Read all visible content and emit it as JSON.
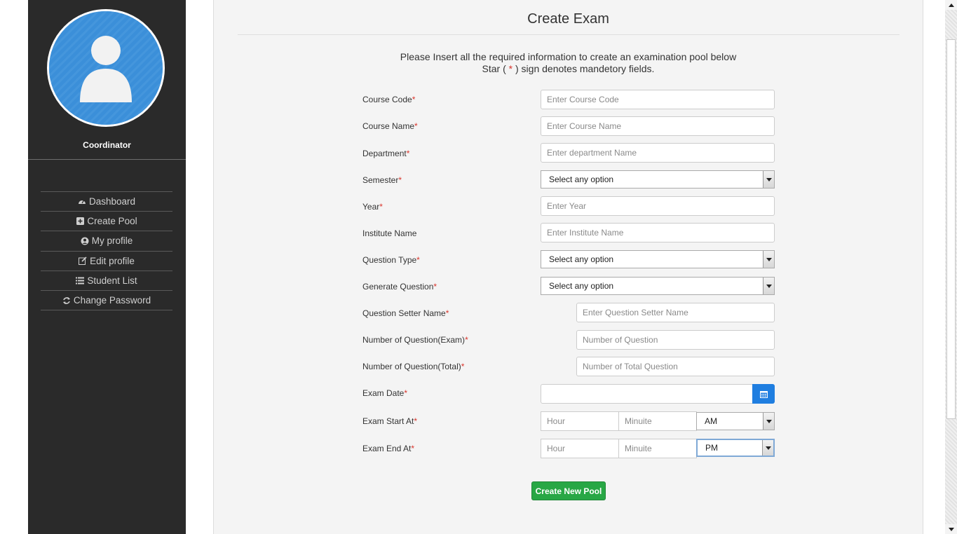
{
  "sidebar": {
    "role": "Coordinator",
    "nav": [
      {
        "label": "Dashboard",
        "icon": "dashboard-icon"
      },
      {
        "label": "Create Pool",
        "icon": "plus-square-icon"
      },
      {
        "label": "My profile",
        "icon": "user-circle-icon"
      },
      {
        "label": "Edit profile",
        "icon": "edit-icon"
      },
      {
        "label": "Student List",
        "icon": "list-icon"
      },
      {
        "label": "Change Password",
        "icon": "refresh-icon"
      }
    ]
  },
  "form": {
    "title": "Create Exam",
    "intro_line1": "Please Insert all the required information to create an examination pool below",
    "intro_line2_pre": "Star (",
    "intro_line2_star": " * ",
    "intro_line2_post": ") sign denotes mandetory fields.",
    "required_mark": "*",
    "fields": {
      "course_code": {
        "label": "Course Code",
        "placeholder": "Enter Course Code"
      },
      "course_name": {
        "label": "Course Name",
        "placeholder": "Enter Course Name"
      },
      "department": {
        "label": "Department",
        "placeholder": "Enter department Name"
      },
      "semester": {
        "label": "Semester",
        "value": "Select any option"
      },
      "year": {
        "label": "Year",
        "placeholder": "Enter Year"
      },
      "institute": {
        "label": "Institute Name",
        "placeholder": "Enter Institute Name"
      },
      "question_type": {
        "label": "Question Type",
        "value": "Select any option"
      },
      "generate_question": {
        "label": "Generate Question",
        "value": "Select any option"
      },
      "setter_name": {
        "label": "Question Setter Name",
        "placeholder": "Enter Question Setter Name"
      },
      "num_exam": {
        "label": "Number of Question(Exam)",
        "placeholder": "Number of Question"
      },
      "num_total": {
        "label": "Number of Question(Total)",
        "placeholder": "Number of Total Question"
      },
      "exam_date": {
        "label": "Exam Date",
        "value": ""
      },
      "start": {
        "label": "Exam Start At",
        "hour": "Hour",
        "minute": "Minuite",
        "ampm": "AM"
      },
      "end": {
        "label": "Exam End At",
        "hour": "Hour",
        "minute": "Minuite",
        "ampm": "PM"
      }
    },
    "submit_label": "Create New Pool"
  },
  "colors": {
    "sidebar_bg": "#2a2a2a",
    "avatar_bg": "#3b8fd9",
    "required": "#d9342b",
    "submit_bg": "#28a745",
    "calendar_bg": "#1f7ee0"
  }
}
